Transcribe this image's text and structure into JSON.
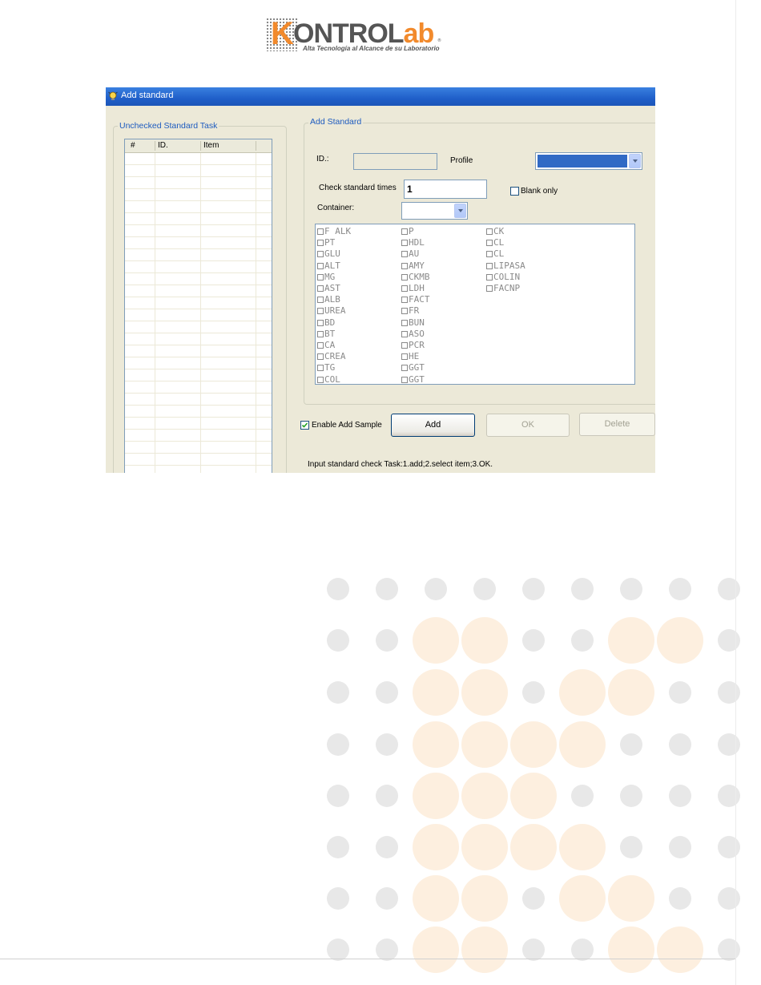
{
  "logo": {
    "k": "K",
    "name_main": "ONTROL",
    "name_lab": "ab",
    "tagline": "Alta Tecnología al Alcance de su Laboratorio",
    "reg": "®"
  },
  "window": {
    "title": "Add standard",
    "left_group": {
      "legend": "Unchecked Standard Task",
      "columns": [
        "#",
        "ID.",
        "Item"
      ]
    },
    "add_group": {
      "legend": "Add Standard",
      "id_label": "ID.:",
      "id_value": "",
      "profile_label": "Profile",
      "profile_value": "",
      "check_times_label": "Check standard times",
      "check_times_value": "1",
      "blank_only_label": "Blank only",
      "blank_only_checked": false,
      "container_label": "Container:",
      "container_value": ""
    },
    "items": {
      "col1": [
        "F ALK",
        "PT",
        "GLU",
        "ALT",
        "MG",
        "AST",
        "ALB",
        "UREA",
        "BD",
        "BT",
        "CA",
        "CREA",
        "TG",
        "COL"
      ],
      "col2": [
        "P",
        "HDL",
        "AU",
        "AMY",
        "CKMB",
        "LDH",
        "FACT",
        "FR",
        "BUN",
        "ASO",
        "PCR",
        "HE",
        "GGT",
        "GGT"
      ],
      "col3": [
        "CK",
        "CL",
        "CL",
        "LIPASA",
        "COLIN",
        "FACNP"
      ]
    },
    "enable_add_sample_label": "Enable Add Sample",
    "enable_add_sample_checked": true,
    "buttons": {
      "add": "Add",
      "ok": "OK",
      "delete": "Delete"
    },
    "status": "Input standard check Task:1.add;2.select item;3.OK."
  },
  "colors": {
    "dot_gray": "#e8e8e8",
    "dot_orange": "#fdefdf",
    "accent_orange": "#f28a2c"
  }
}
